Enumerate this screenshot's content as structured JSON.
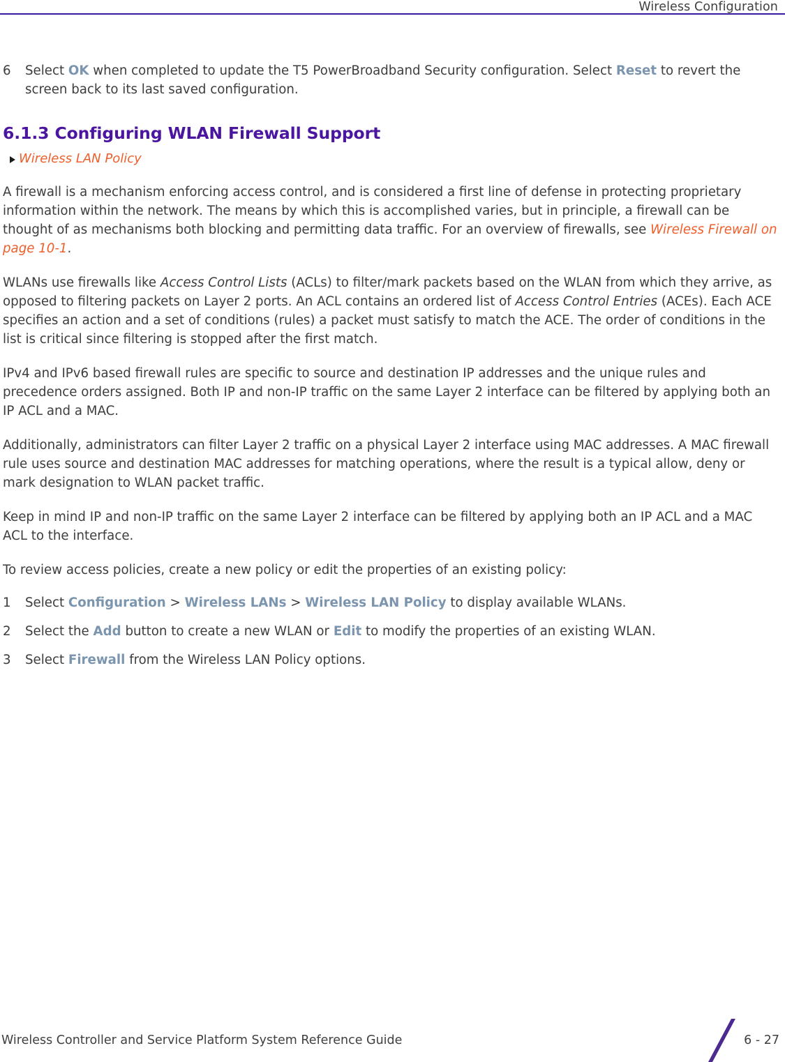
{
  "header": {
    "title": "Wireless Configuration",
    "rule_color": "#36199c"
  },
  "colors": {
    "heading_purple": "#4b169f",
    "link_orange": "#ef5f2c",
    "ui_bold_blue": "#7b95ae",
    "body_text": "#3d3d3d",
    "rule_purple": "#36199c",
    "footer_slash": "#4b2a91"
  },
  "step6": {
    "number": "6",
    "text_1": "Select ",
    "ui_1": "OK",
    "text_2": " when completed to update the T5 PowerBroadband Security configuration. Select ",
    "ui_2": "Reset",
    "text_3": " to revert the screen back to its last saved configuration."
  },
  "section": {
    "heading": "6.1.3 Configuring WLAN Firewall Support",
    "xref": "Wireless LAN Policy",
    "bullet_icon": "triangle-right-icon"
  },
  "paragraphs": {
    "p1_a": "A firewall is a mechanism enforcing access control, and is considered a first line of defense in protecting proprietary information within the network. The means by which this is accomplished varies, but in principle, a firewall can be thought of as mechanisms both blocking and permitting data traffic. For an overview of firewalls, see ",
    "p1_xref": "Wireless Firewall on page 10-1",
    "p1_b": ".",
    "p2_a": "WLANs use firewalls like ",
    "p2_i1": "Access Control Lists",
    "p2_b": " (ACLs) to filter/mark packets based on the WLAN from which they arrive, as opposed to filtering packets on Layer 2 ports. An ACL contains an ordered list of ",
    "p2_i2": "Access Control Entries",
    "p2_c": " (ACEs). Each ACE specifies an action and a set of conditions (rules) a packet must satisfy to match the ACE. The order of conditions in the list is critical since filtering is stopped after the first match.",
    "p3": "IPv4 and IPv6 based firewall rules are specific to source and destination IP addresses and the unique rules and precedence orders assigned. Both IP and non-IP traffic on the same Layer 2 interface can be filtered by applying both an IP ACL and a MAC.",
    "p4": "Additionally, administrators can filter Layer 2 traffic on a physical Layer 2 interface using MAC addresses. A MAC firewall rule uses source and destination MAC addresses for matching operations, where the result is a typical allow, deny or mark designation to WLAN packet traffic.",
    "p5": "Keep in mind IP and non-IP traffic on the same Layer 2 interface can be filtered by applying both an IP ACL and a MAC ACL to the interface.",
    "p6": "To review access policies, create a new policy or edit the properties of an existing policy:"
  },
  "steps": [
    {
      "number": "1",
      "text_1": "Select ",
      "ui_1": "Configuration",
      "sep_1": " > ",
      "ui_2": "Wireless LANs",
      "sep_2": " > ",
      "ui_3": "Wireless LAN Policy",
      "text_2": " to display available WLANs."
    },
    {
      "number": "2",
      "text_1": "Select the ",
      "ui_1": "Add",
      "text_2": " button to create a new WLAN or ",
      "ui_2": "Edit",
      "text_3": " to modify the properties of an existing WLAN."
    },
    {
      "number": "3",
      "text_1": "Select ",
      "ui_1": "Firewall",
      "text_2": " from the Wireless LAN Policy options."
    }
  ],
  "footer": {
    "title": "Wireless Controller and Service Platform System Reference Guide",
    "page_number": "6 - 27"
  }
}
